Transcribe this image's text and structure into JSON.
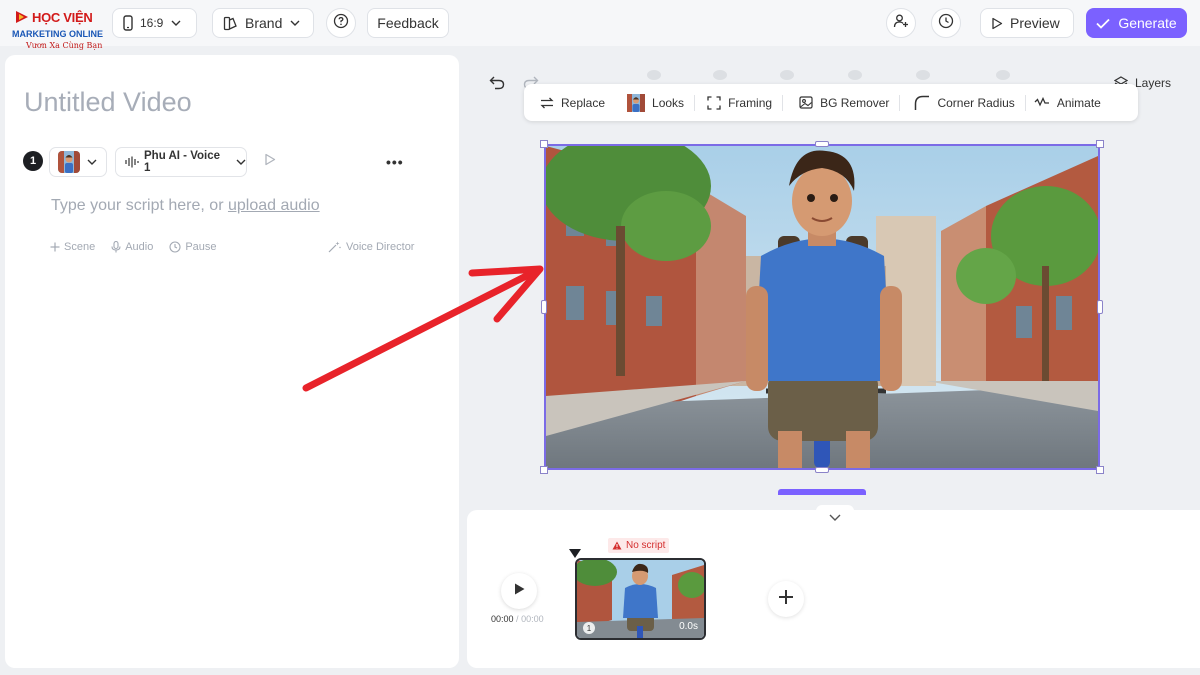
{
  "brand": {
    "logo_main": "HỌC VIỆN",
    "logo_sub": "MARKETING ONLINE",
    "logo_tagline": "Vươn Xa Cùng Bạn"
  },
  "topbar": {
    "aspect_ratio": "16:9",
    "brand_label": "Brand",
    "help_icon": "question-icon",
    "feedback_label": "Feedback",
    "preview_label": "Preview",
    "generate_label": "Generate",
    "accent_color": "#7b61ff"
  },
  "editor": {
    "title_placeholder": "Untitled Video",
    "scene_number": "1",
    "voice_label": "Phu AI - Voice 1",
    "script_placeholder": "Type your script here, or",
    "upload_link": "upload audio",
    "tools": [
      "Scene",
      "Audio",
      "Pause"
    ],
    "voice_director": "Voice Director"
  },
  "canvas": {
    "layers_label": "Layers",
    "toolbar": [
      {
        "label": "Replace",
        "icon": "replace-icon"
      },
      {
        "label": "Looks",
        "icon": "avatar-thumb-icon"
      },
      {
        "label": "Framing",
        "icon": "framing-icon"
      },
      {
        "label": "BG Remover",
        "icon": "image-icon"
      },
      {
        "label": "Corner Radius",
        "icon": "corner-radius-icon"
      },
      {
        "label": "Animate",
        "icon": "animate-icon"
      }
    ]
  },
  "timeline": {
    "current_time": "00:00",
    "total_time": "00:00",
    "warning": "No script",
    "clip_number": "1",
    "clip_duration": "0.0s"
  }
}
